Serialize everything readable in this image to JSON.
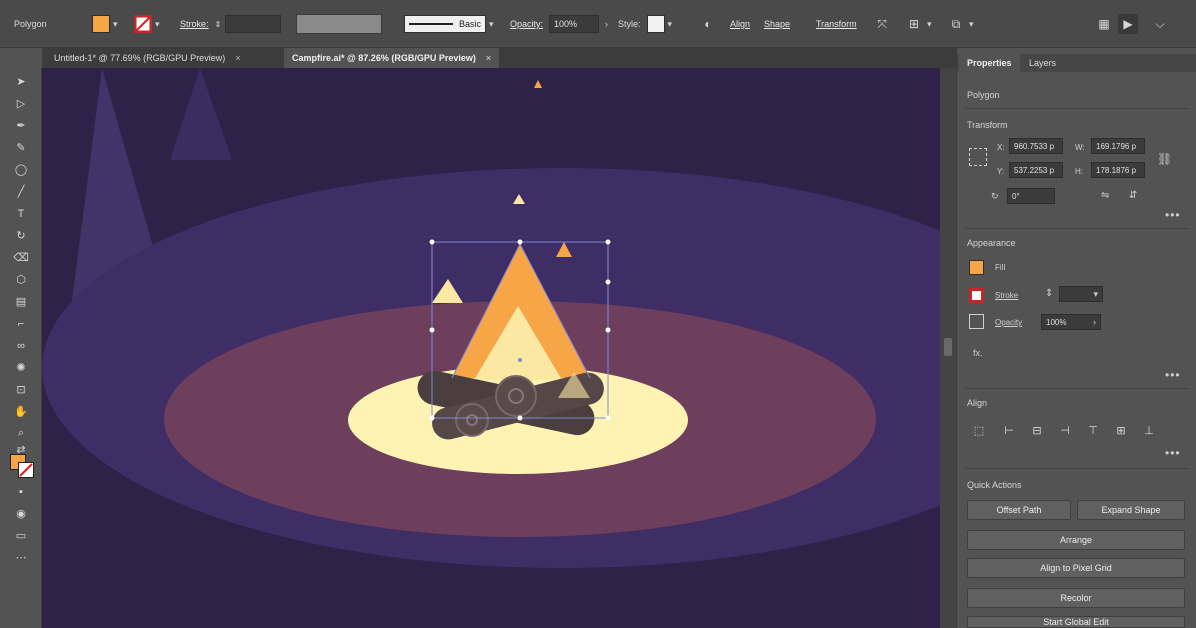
{
  "controlbar": {
    "selection_type": "Polygon",
    "stroke_label": "Stroke:",
    "brush_label": "Basic",
    "opacity_label": "Opacity:",
    "opacity_value": "100%",
    "style_label": "Style:",
    "align_link": "Align",
    "shape_link": "Shape",
    "transform_link": "Transform",
    "fill_color": "#f6a647"
  },
  "tabs": [
    {
      "label": "Untitled-1* @ 77.69% (RGB/GPU Preview)",
      "close": "×"
    },
    {
      "label": "Campfire.ai* @ 87.26% (RGB/GPU Preview)",
      "close": "×"
    }
  ],
  "panel": {
    "tabs": [
      "Properties",
      "Layers"
    ],
    "selection_type": "Polygon",
    "transform": {
      "title": "Transform",
      "x_label": "X:",
      "x_value": "960.7533 p",
      "y_label": "Y:",
      "y_value": "537.2253 p",
      "w_label": "W:",
      "w_value": "169.1796 p",
      "h_label": "H:",
      "h_value": "178.1876 p",
      "angle_value": "0°"
    },
    "appearance": {
      "title": "Appearance",
      "fill_label": "Fill",
      "stroke_label": "Stroke",
      "opacity_label": "Opacity",
      "opacity_value": "100%",
      "fx_label": "fx."
    },
    "align": {
      "title": "Align"
    },
    "quick_actions": {
      "title": "Quick Actions",
      "buttons": [
        "Offset Path",
        "Expand Shape",
        "Arrange",
        "Align to Pixel Grid",
        "Recolor",
        "Start Global Edit"
      ]
    }
  },
  "colors": {
    "sky": "#2f2148",
    "ground": "#3f2d66",
    "glow_outer": "#6e3f5c",
    "glow_inner": "#fff3b3",
    "flame_orange": "#f6a647",
    "flame_yellow": "#fbe8a3",
    "log": "#4a3e3e",
    "selection": "#7e8ad8"
  }
}
